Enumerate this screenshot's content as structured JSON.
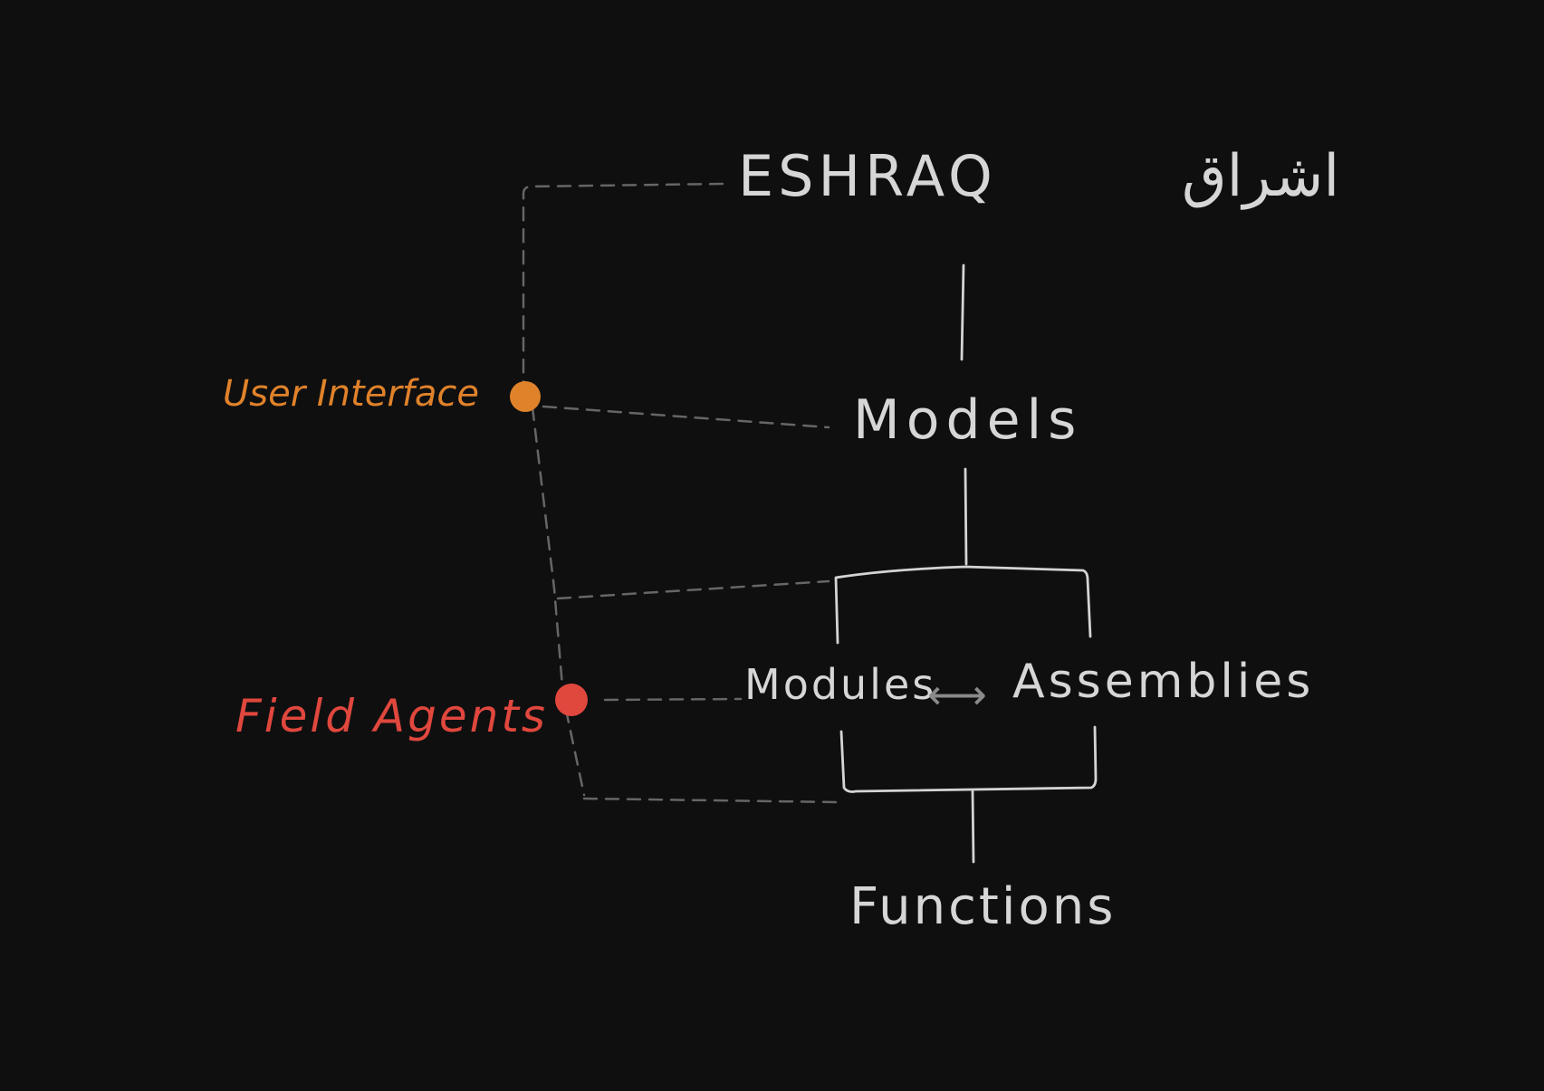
{
  "colors": {
    "background": "#0f0f10",
    "ink": "#d8d8d8",
    "dashed": "#6b6b6b",
    "user_interface": "#e0822a",
    "field_agents": "#e0473d"
  },
  "diagram": {
    "title_latin": "ESHRAQ",
    "title_arabic": "اشراق",
    "models": "Models",
    "modules": "Modules",
    "arrow": "⟷",
    "assemblies": "Assemblies",
    "functions": "Functions",
    "user_interface": "User Interface",
    "field_agents": "Field Agents"
  }
}
